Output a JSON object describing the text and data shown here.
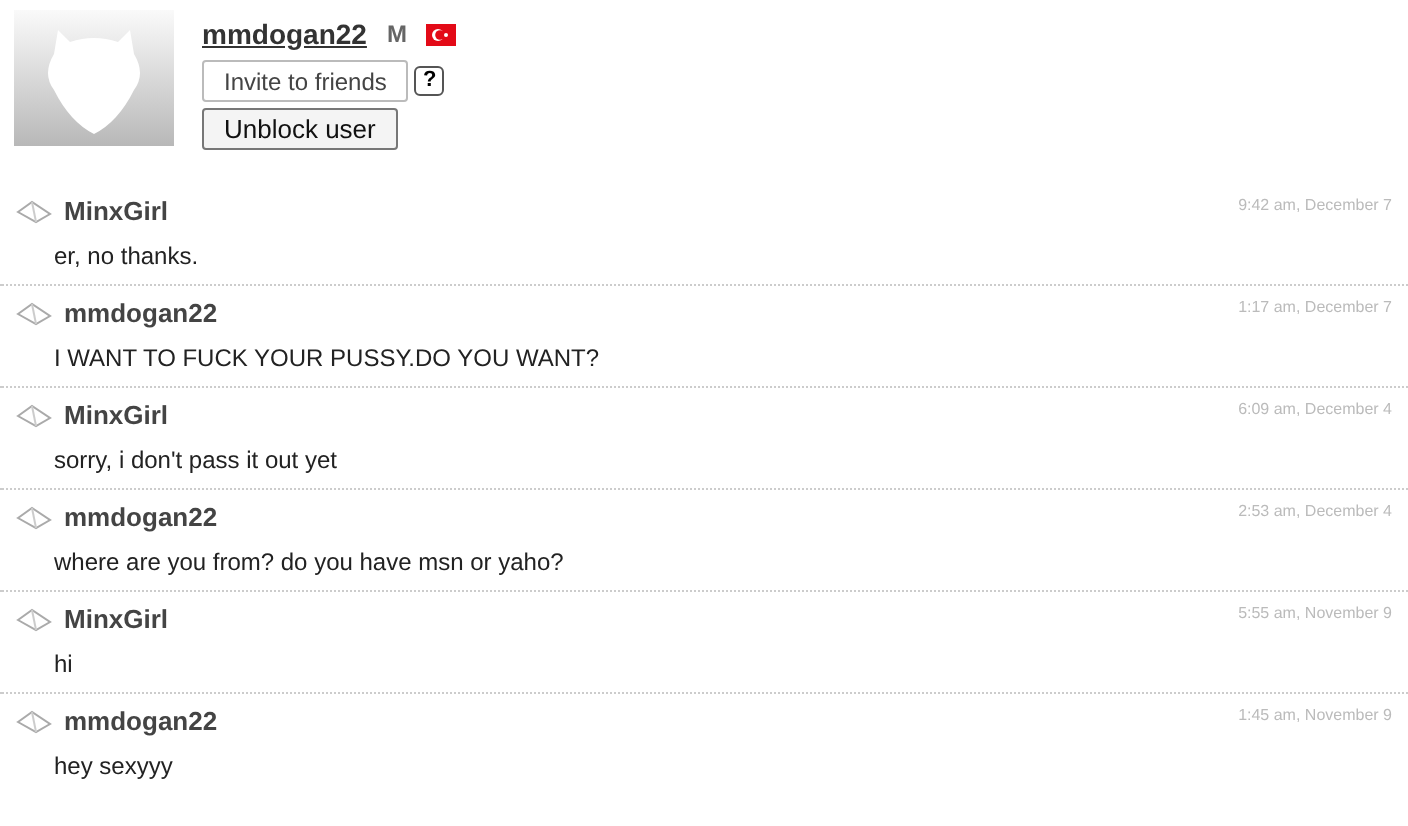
{
  "profile": {
    "username": "mmdogan22",
    "gender": "M",
    "buttons": [
      "Invite to friends",
      "Unblock user"
    ],
    "help": "?"
  },
  "messages": [
    {
      "sender": "MinxGirl",
      "time": "9:42 am, December 7",
      "text": "er, no thanks."
    },
    {
      "sender": "mmdogan22",
      "time": "1:17 am, December 7",
      "text": "I WANT TO FUCK YOUR PUSSY.DO YOU WANT?"
    },
    {
      "sender": "MinxGirl",
      "time": "6:09 am, December 4",
      "text": "sorry, i don't pass it out yet"
    },
    {
      "sender": "mmdogan22",
      "time": "2:53 am, December 4",
      "text": "where are you from? do you have msn or yaho?"
    },
    {
      "sender": "MinxGirl",
      "time": "5:55 am, November 9",
      "text": "hi"
    },
    {
      "sender": "mmdogan22",
      "time": "1:45 am, November 9",
      "text": "hey sexyyy"
    }
  ]
}
